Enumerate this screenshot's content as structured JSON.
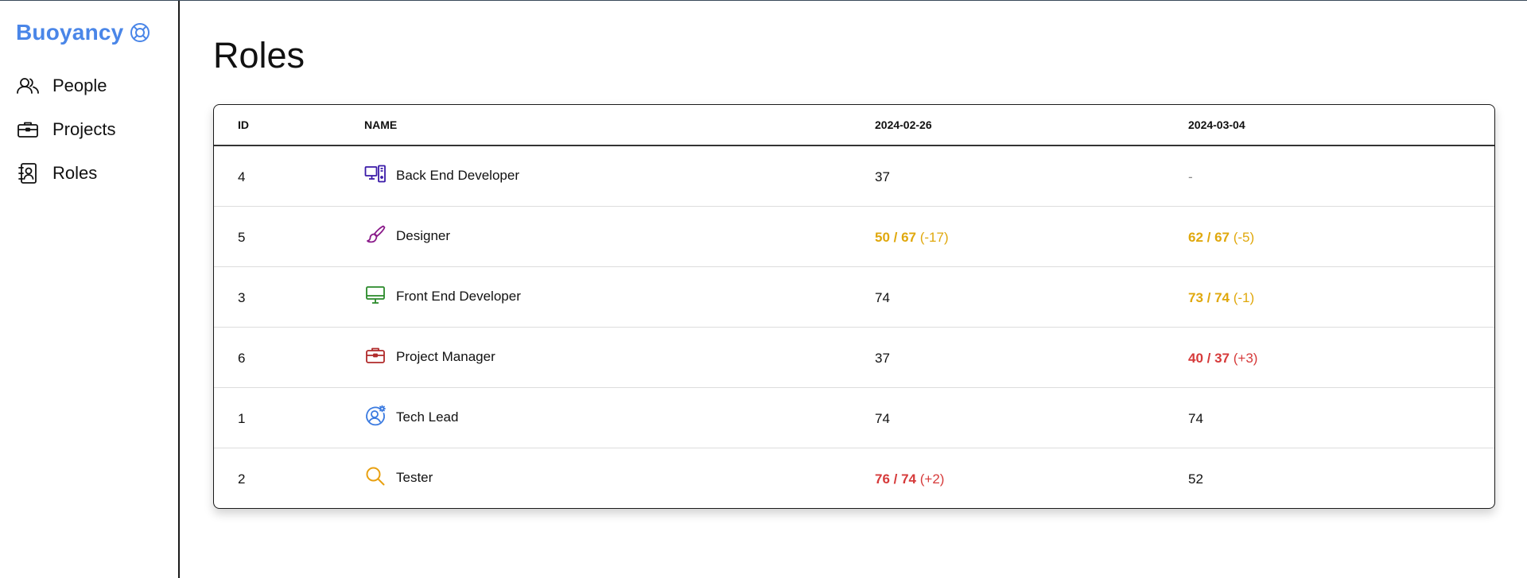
{
  "app": {
    "brand": "Buoyancy",
    "brand_icon": "lifebuoy-icon",
    "brand_color": "#4a86e8"
  },
  "sidebar": {
    "items": [
      {
        "label": "People",
        "icon": "people-icon"
      },
      {
        "label": "Projects",
        "icon": "briefcase-icon"
      },
      {
        "label": "Roles",
        "icon": "contact-card-icon"
      }
    ]
  },
  "page": {
    "title": "Roles"
  },
  "table": {
    "columns": [
      "ID",
      "NAME",
      "2024-02-26",
      "2024-03-04"
    ],
    "rows": [
      {
        "id": "4",
        "name": "Back End Developer",
        "icon": "server-desktop-icon",
        "icon_color": "#3a1aa8",
        "d1": {
          "main": "37",
          "delta": "",
          "status": "normal"
        },
        "d2": {
          "main": "-",
          "delta": "",
          "status": "empty"
        }
      },
      {
        "id": "5",
        "name": "Designer",
        "icon": "paintbrush-icon",
        "icon_color": "#8a1a8a",
        "d1": {
          "main": "50 / 67",
          "delta": "(-17)",
          "status": "under"
        },
        "d2": {
          "main": "62 / 67",
          "delta": "(-5)",
          "status": "under"
        }
      },
      {
        "id": "3",
        "name": "Front End Developer",
        "icon": "monitor-icon",
        "icon_color": "#2a8a2a",
        "d1": {
          "main": "74",
          "delta": "",
          "status": "normal"
        },
        "d2": {
          "main": "73 / 74",
          "delta": "(-1)",
          "status": "under"
        }
      },
      {
        "id": "6",
        "name": "Project Manager",
        "icon": "briefcase-icon",
        "icon_color": "#b02a2a",
        "d1": {
          "main": "37",
          "delta": "",
          "status": "normal"
        },
        "d2": {
          "main": "40 / 37",
          "delta": "(+3)",
          "status": "over"
        }
      },
      {
        "id": "1",
        "name": "Tech Lead",
        "icon": "user-gear-icon",
        "icon_color": "#3a7ae0",
        "d1": {
          "main": "74",
          "delta": "",
          "status": "normal"
        },
        "d2": {
          "main": "74",
          "delta": "",
          "status": "normal"
        }
      },
      {
        "id": "2",
        "name": "Tester",
        "icon": "magnifier-icon",
        "icon_color": "#e8a010",
        "d1": {
          "main": "76 / 74",
          "delta": "(+2)",
          "status": "over"
        },
        "d2": {
          "main": "52",
          "delta": "",
          "status": "normal"
        }
      }
    ]
  },
  "colors": {
    "under": "#e0a80d",
    "over": "#d63a3a"
  }
}
